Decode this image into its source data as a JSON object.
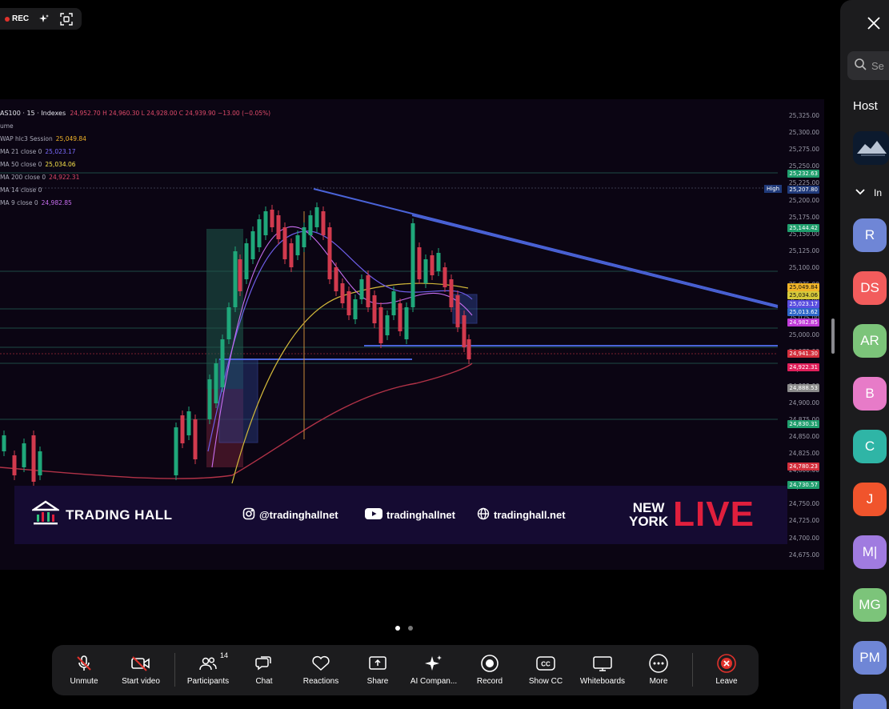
{
  "status_bar": {
    "rec_label": "REC",
    "icons": [
      "sparkle-icon",
      "screen-select-icon"
    ]
  },
  "chart": {
    "header": "AS100 · 15 · Indexes",
    "ohlc": "24,952.70  H 24,960.30  L 24,928.00  C 24,939.90  −13.00 (−0.05%)",
    "legend": [
      {
        "label": "ume",
        "value": "",
        "color": "#8a8aa0"
      },
      {
        "label": "WAP hlc3 Session",
        "value": "25,049.84",
        "color": "#f0b429"
      },
      {
        "label": "MA 21 close 0",
        "value": "25,023.17",
        "color": "#7b6cff"
      },
      {
        "label": "MA 50 close 0",
        "value": "25,034.06",
        "color": "#f5e14a"
      },
      {
        "label": "MA 200 close 0",
        "value": "24,922.31",
        "color": "#e04a6a"
      },
      {
        "label": "MA 14 close 0",
        "value": "",
        "color": "#5a7adf"
      },
      {
        "label": "MA 9 close 0",
        "value": "24,982.85",
        "color": "#c86ef0"
      }
    ],
    "price_ticks": [
      "25,325.00",
      "25,300.00",
      "25,275.00",
      "25,250.00",
      "25,225.00",
      "25,200.00",
      "25,175.00",
      "25,150.00",
      "25,125.00",
      "25,100.00",
      "25,075.00",
      "25,050.00",
      "25,025.00",
      "25,000.00",
      "24,975.00",
      "24,950.00",
      "24,925.00",
      "24,900.00",
      "24,875.00",
      "24,850.00",
      "24,825.00",
      "24,800.00",
      "24,775.00",
      "24,750.00",
      "24,725.00",
      "24,700.00",
      "24,675.00"
    ],
    "price_tags": [
      {
        "text": "25,232.63",
        "color": "#1f9e6d"
      },
      {
        "text": "25,207.80",
        "color": "#203a7a"
      },
      {
        "text": "25,144.42",
        "color": "#1f9e6d"
      },
      {
        "text": "25,049.84",
        "color": "#f0b429"
      },
      {
        "text": "25,034.06",
        "color": "#d6c93a"
      },
      {
        "text": "25,023.17",
        "color": "#5a4ee0"
      },
      {
        "text": "25,013.62",
        "color": "#2e67c8"
      },
      {
        "text": "24,982.85",
        "color": "#c03ad8"
      },
      {
        "text": "24,941.30",
        "color": "#d32f3c"
      },
      {
        "text": "24,922.31",
        "color": "#e01f5a"
      },
      {
        "text": "24,888.53",
        "color": "#8a8a8a"
      },
      {
        "text": "24,830.31",
        "color": "#1f9e6d"
      },
      {
        "text": "24,780.23",
        "color": "#d32f3c"
      },
      {
        "text": "24,730.57",
        "color": "#1f9e6d"
      }
    ],
    "high_label": "High"
  },
  "banner": {
    "brand": "TRADING HALL",
    "instagram": "@tradinghallnet",
    "youtube": "tradinghallnet",
    "website": "tradinghall.net",
    "ny_line1": "NEW",
    "ny_line2": "YORK",
    "live": "LIVE"
  },
  "toolbar": {
    "unmute": "Unmute",
    "start_video": "Start video",
    "participants": "Participants",
    "participants_count": "14",
    "chat": "Chat",
    "reactions": "Reactions",
    "share": "Share",
    "ai_companion": "AI Compan...",
    "record": "Record",
    "show_cc": "Show CC",
    "whiteboards": "Whiteboards",
    "more": "More",
    "leave": "Leave"
  },
  "panel": {
    "search_placeholder": "Se",
    "host_label": "Host",
    "section_label": "In",
    "participants": [
      {
        "initials": "R",
        "color": "#6f86d6"
      },
      {
        "initials": "DS",
        "color": "#f25c5c"
      },
      {
        "initials": "AR",
        "color": "#7cc47a"
      },
      {
        "initials": "B",
        "color": "#e77bc8"
      },
      {
        "initials": "C",
        "color": "#2fb5a6"
      },
      {
        "initials": "J",
        "color": "#f0542c"
      },
      {
        "initials": "M|",
        "color": "#a07be0"
      },
      {
        "initials": "MG",
        "color": "#7cc47a"
      },
      {
        "initials": "PM",
        "color": "#6f86d6"
      },
      {
        "initials": "",
        "color": "#6f86d6"
      }
    ]
  },
  "colors": {
    "toolbar_bg": "#1c1c1e",
    "leave_red": "#e0322c",
    "live_red": "#e01f3d",
    "banner_bg": "#150b32",
    "chart_bg": "#0b0513"
  }
}
